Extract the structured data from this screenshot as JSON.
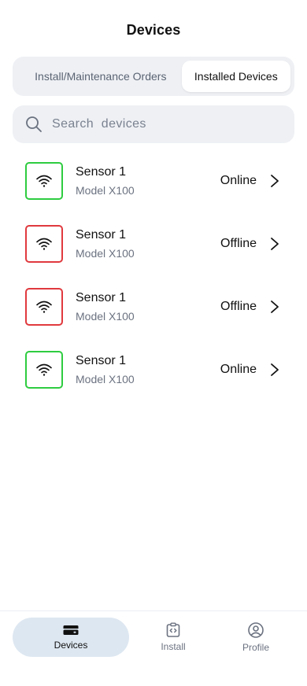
{
  "header": {
    "title": "Devices"
  },
  "tabs": [
    {
      "label": "Install/Maintenance Orders",
      "active": false
    },
    {
      "label": "Installed Devices",
      "active": true
    }
  ],
  "search": {
    "placeholder": "Search  devices",
    "value": ""
  },
  "devices": [
    {
      "name": "Sensor 1",
      "model": "Model X100",
      "status": "Online"
    },
    {
      "name": "Sensor 1",
      "model": "Model X100",
      "status": "Offline"
    },
    {
      "name": "Sensor 1",
      "model": "Model X100",
      "status": "Offline"
    },
    {
      "name": "Sensor 1",
      "model": "Model X100",
      "status": "Online"
    }
  ],
  "bottom_nav": {
    "items": [
      {
        "label": "Devices",
        "icon": "device-icon",
        "active": true
      },
      {
        "label": "Install",
        "icon": "install-icon",
        "active": false
      },
      {
        "label": "Profile",
        "icon": "profile-icon",
        "active": false
      }
    ]
  },
  "colors": {
    "online": "#2ecc40",
    "offline": "#e0393e",
    "active_nav_bg": "#dde7f1",
    "surface": "#eef0f4"
  }
}
